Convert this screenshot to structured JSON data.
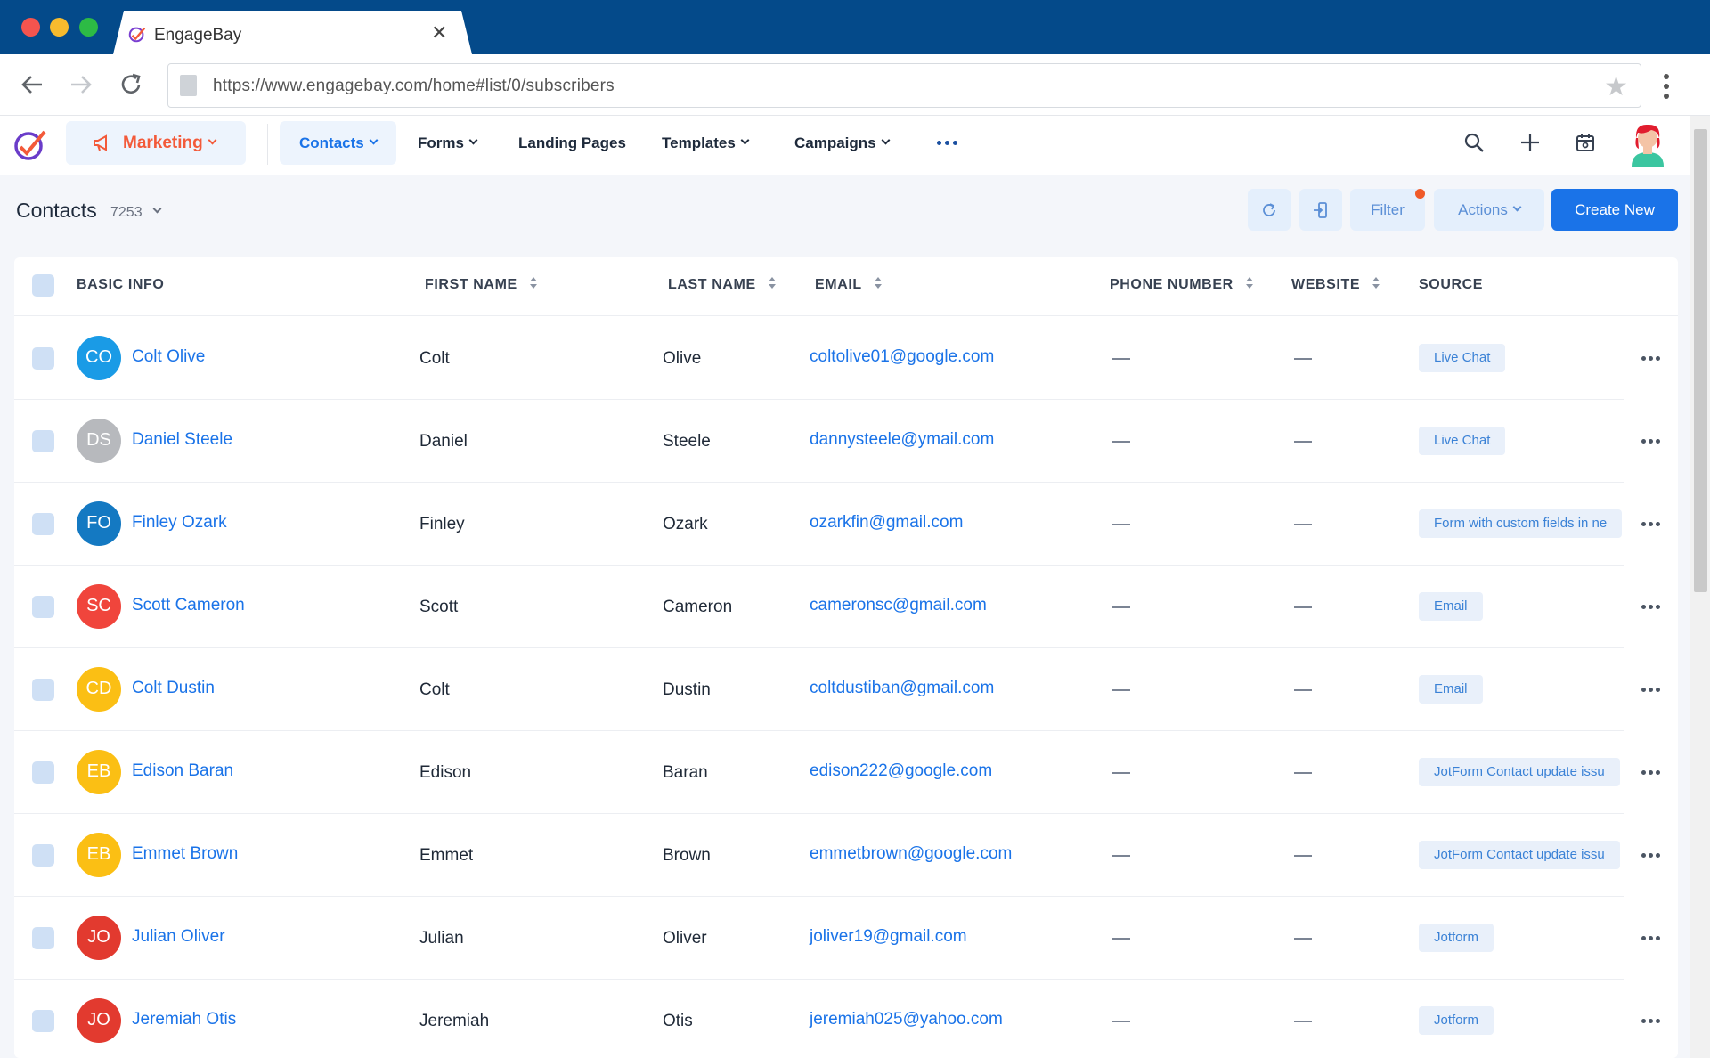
{
  "browser": {
    "tab_title": "EngageBay",
    "url": "https://www.engagebay.com/home#list/0/subscribers"
  },
  "nav": {
    "module": "Marketing",
    "items": [
      {
        "label": "Contacts"
      },
      {
        "label": "Forms"
      },
      {
        "label": "Landing Pages"
      },
      {
        "label": "Templates"
      },
      {
        "label": "Campaigns"
      }
    ]
  },
  "page": {
    "title": "Contacts",
    "count": "7253",
    "filter_label": "Filter",
    "actions_label": "Actions",
    "create_label": "Create New"
  },
  "table": {
    "headers": {
      "basic": "BASIC INFO",
      "first": "FIRST NAME",
      "last": "LAST NAME",
      "email": "EMAIL",
      "phone": "PHONE NUMBER",
      "website": "WEBSITE",
      "source": "SOURCE"
    },
    "rows": [
      {
        "initials": "CO",
        "color": "#1a9be6",
        "name": "Colt Olive",
        "first": "Colt",
        "last": "Olive",
        "email": "coltolive01@google.com",
        "source": "Live Chat"
      },
      {
        "initials": "DS",
        "color": "#b7b9bd",
        "name": "Daniel Steele",
        "first": "Daniel",
        "last": "Steele",
        "email": "dannysteele@ymail.com",
        "source": "Live Chat"
      },
      {
        "initials": "FO",
        "color": "#1479c2",
        "name": "Finley Ozark",
        "first": "Finley",
        "last": "Ozark",
        "email": "ozarkfin@gmail.com",
        "source": "Form with custom fields in ne"
      },
      {
        "initials": "SC",
        "color": "#f0453c",
        "name": "Scott Cameron",
        "first": "Scott",
        "last": "Cameron",
        "email": "cameronsc@gmail.com",
        "source": "Email"
      },
      {
        "initials": "CD",
        "color": "#fbbf14",
        "name": "Colt Dustin",
        "first": "Colt",
        "last": "Dustin",
        "email": "coltdustiban@gmail.com",
        "source": "Email"
      },
      {
        "initials": "EB",
        "color": "#fbbf14",
        "name": "Edison Baran",
        "first": "Edison",
        "last": "Baran",
        "email": "edison222@google.com",
        "source": "JotForm Contact update issu"
      },
      {
        "initials": "EB",
        "color": "#fbbf14",
        "name": "Emmet Brown",
        "first": "Emmet",
        "last": "Brown",
        "email": "emmetbrown@google.com",
        "source": "JotForm Contact update issu"
      },
      {
        "initials": "JO",
        "color": "#e23a2f",
        "name": "Julian Oliver",
        "first": "Julian",
        "last": "Oliver",
        "email": "joliver19@gmail.com",
        "source": "Jotform"
      },
      {
        "initials": "JO",
        "color": "#e23a2f",
        "name": "Jeremiah Otis",
        "first": "Jeremiah",
        "last": "Otis",
        "email": "jeremiah025@yahoo.com",
        "source": "Jotform"
      }
    ]
  }
}
